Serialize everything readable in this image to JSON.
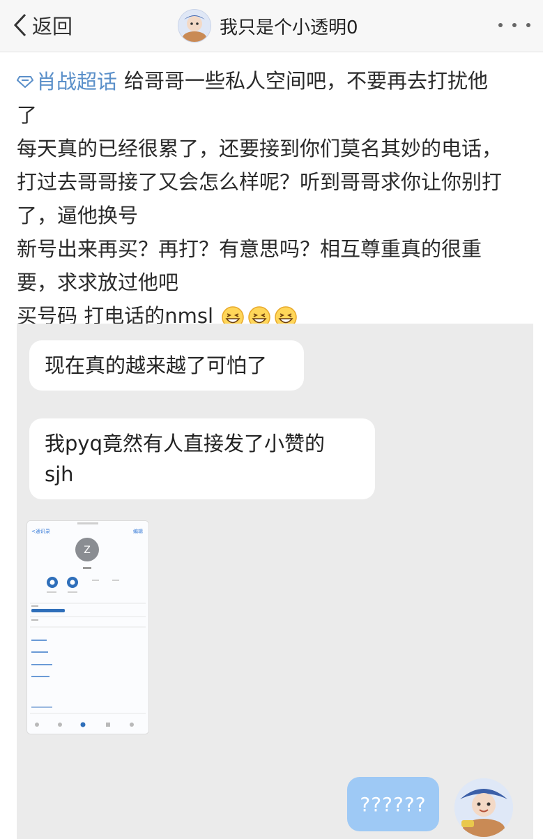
{
  "navbar": {
    "back_label": "返回",
    "title": "我只是个小透明0"
  },
  "post": {
    "tag": "肖战超话",
    "lines": [
      "给哥哥一些私人空间吧，不要再去打扰他",
      "了",
      "每天真的已经很累了，还要接到你们莫名其妙的电话，",
      "打过去哥哥接了又会怎么样呢？听到哥哥求你让你别打",
      "了，逼他换号",
      "新号出来再买？再打？有意思吗？相互尊重真的很重",
      "要，求求放过他吧",
      "买号码 打电话的nmsl"
    ]
  },
  "chat": {
    "messages": [
      {
        "side": "left",
        "line1": "现在真的越来越了可怕了"
      },
      {
        "side": "left",
        "line1": "我pyq竟然有人直接发了小赞的",
        "line2": "sjh"
      },
      {
        "side": "right",
        "line1": "??????"
      }
    ],
    "phone_screenshot": {
      "avatar_letter": "Z",
      "header_back": "<通讯录",
      "header_right": "编辑"
    }
  },
  "colors": {
    "tag": "#5a8fc9",
    "chat_bg": "#ebebeb",
    "outgoing_bubble": "#9ec9f5"
  },
  "icons": [
    "back-chevron-icon",
    "more-icon",
    "supertopic-icon",
    "grin-emoji-icon"
  ]
}
